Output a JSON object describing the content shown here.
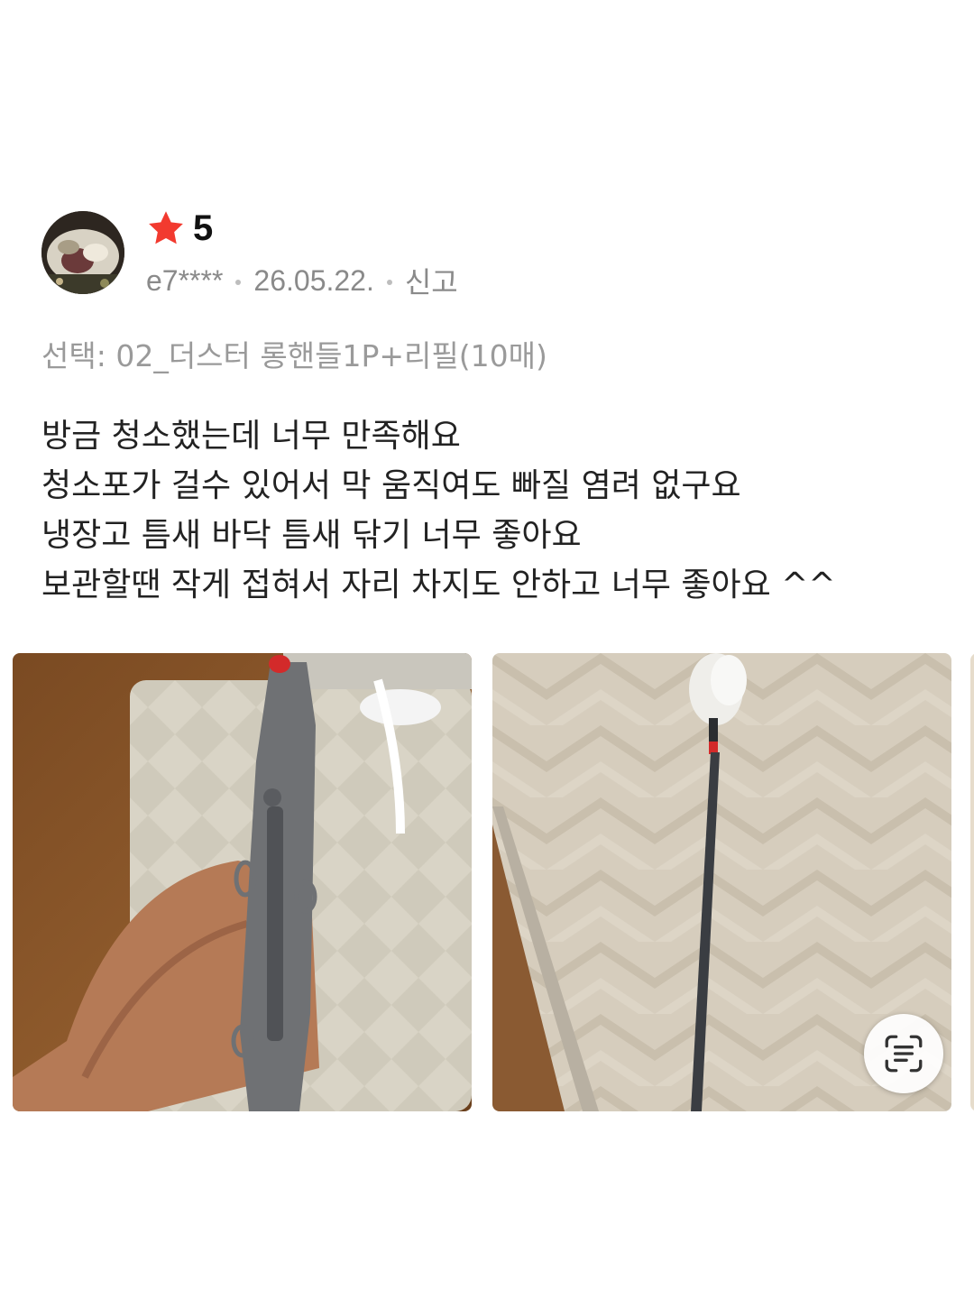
{
  "review": {
    "rating": "5",
    "user": "e7****",
    "date": "26.05.22.",
    "report_label": "신고",
    "option": "선택: 02_더스터 롱핸들1P+리필(10매)",
    "body_lines": [
      "방금 청소했는데 너무 만족해요",
      "청소포가 걸수 있어서 막 움직여도 빠질 염려 없구요",
      "냉장고 틈새 바닥 틈새 닦기 너무 좋아요",
      "보관할땐 작게 접혀서 자리 차지도 안하고 너무 좋아요 ^^"
    ]
  },
  "icons": {
    "star": "star-icon",
    "scan": "text-scan-icon"
  },
  "colors": {
    "star": "#f23a2f",
    "meta_text": "#8a8a8a",
    "option_text": "#9a9a9a",
    "body_text": "#222222"
  }
}
